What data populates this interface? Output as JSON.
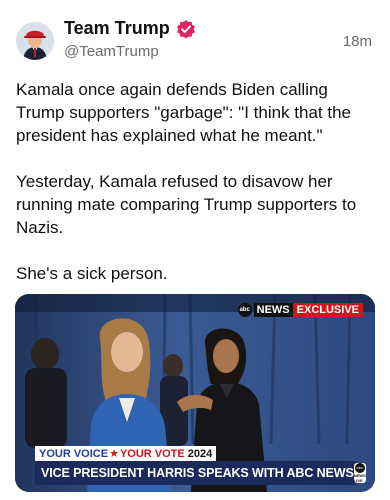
{
  "post": {
    "author": {
      "name": "Team Trump",
      "handle": "@TeamTrump",
      "verified_icon": "verified-badge-icon",
      "avatar_icon": "profile-avatar"
    },
    "time": "18m",
    "paragraphs": [
      "Kamala once again defends Biden calling Trump supporters \"garbage\": \"I think that the president has explained what he meant.\"",
      "Yesterday, Kamala refused to disavow her running mate comparing Trump supporters to Nazis.",
      "She's a sick person."
    ],
    "media": {
      "badge": {
        "logo": "abc",
        "network": "NEWS",
        "tag": "EXCLUSIVE"
      },
      "lower_third": {
        "voice": "YOUR VOICE",
        "star": "★",
        "vote": "YOUR VOTE",
        "year": "2024",
        "headline": "VICE PRESIDENT HARRIS SPEAKS WITH ABC NEWS",
        "logo_abc": "abc",
        "logo_label": "NEWS LIVE"
      }
    }
  },
  "colors": {
    "verified": "#e0245e",
    "news_red": "#d2141e",
    "banner_navy": "#1a2a5a",
    "voice_blue": "#1f3f9a"
  }
}
